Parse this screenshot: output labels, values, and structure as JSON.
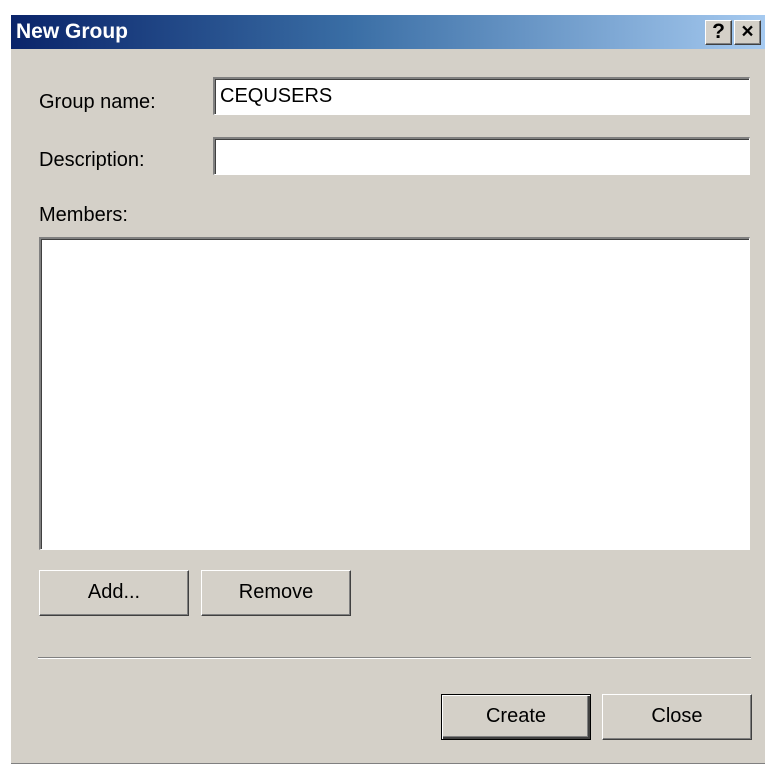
{
  "window": {
    "title": "New Group",
    "help_button": "?",
    "close_button": "×"
  },
  "form": {
    "group_name_label": "Group name:",
    "group_name_value": "CEQUSERS",
    "description_label": "Description:",
    "description_value": "",
    "members_label": "Members:",
    "members": []
  },
  "buttons": {
    "add": "Add...",
    "remove": "Remove",
    "create": "Create",
    "close": "Close"
  },
  "colors": {
    "title_gradient_start": "#0a246a",
    "title_gradient_end": "#a6caf0",
    "dialog_face": "#d4d0c8"
  }
}
